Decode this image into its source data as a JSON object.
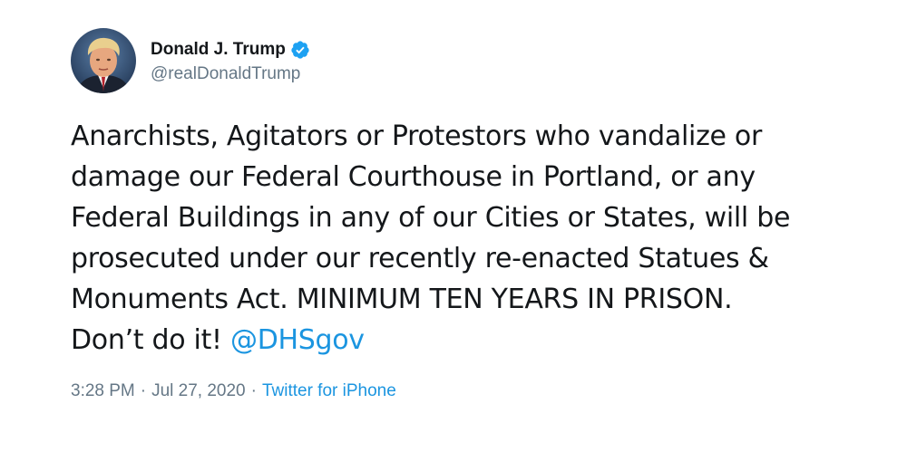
{
  "author": {
    "display_name": "Donald J. Trump",
    "handle": "@realDonaldTrump",
    "verified": true
  },
  "tweet": {
    "lines": [
      "Anarchists, Agitators or Protestors who vandalize or",
      "damage our Federal Courthouse in Portland, or any",
      "Federal Buildings in any of our Cities or States, will be",
      "prosecuted under our recently re-enacted Statues &",
      "Monuments Act. MINIMUM TEN YEARS IN PRISON."
    ],
    "last_line_text": "Don’t do it! ",
    "mention": "@DHSgov"
  },
  "meta": {
    "time": "3:28 PM",
    "separator": "·",
    "date": "Jul 27, 2020",
    "source": "Twitter for iPhone"
  },
  "colors": {
    "link": "#1b95e0",
    "secondary_text": "#657786",
    "primary_text": "#14171a",
    "verified_badge": "#1da1f2"
  },
  "icons": {
    "verified": "verified-badge-icon"
  }
}
